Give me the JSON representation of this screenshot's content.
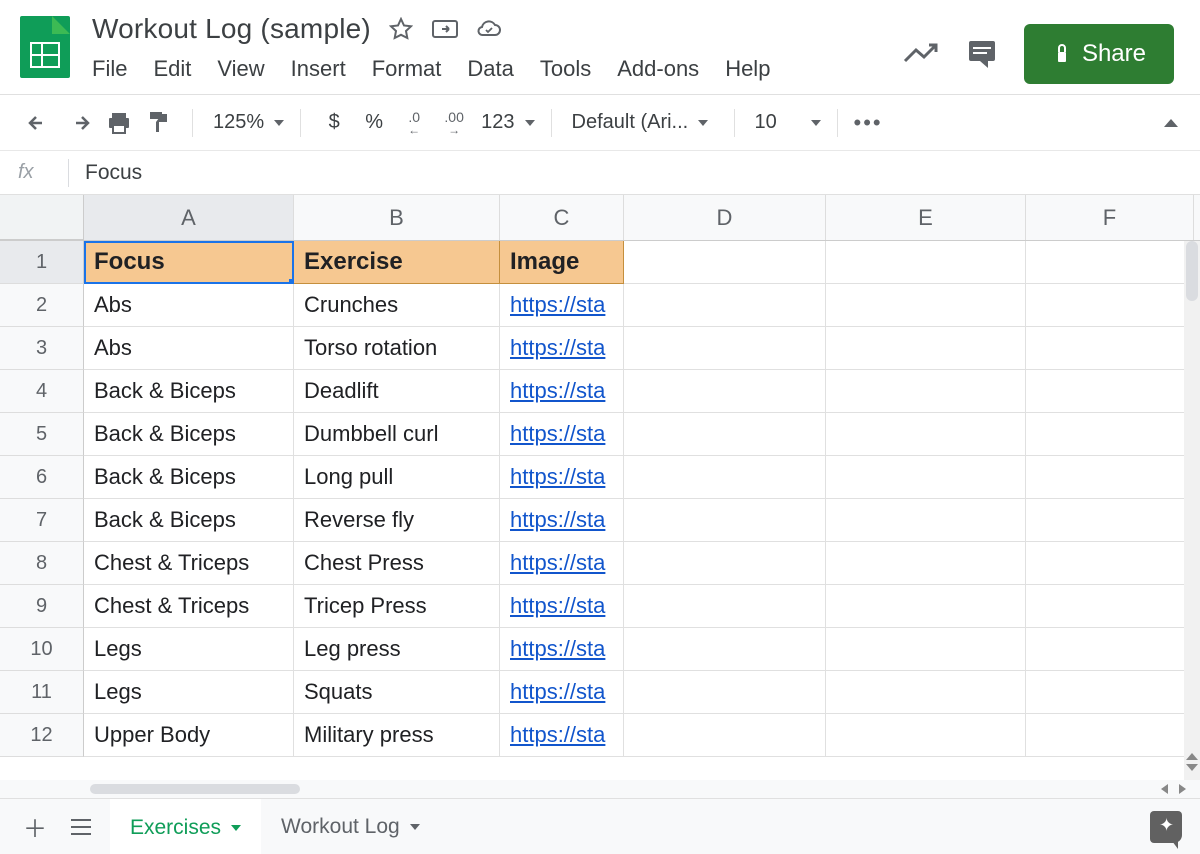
{
  "doc": {
    "title": "Workout Log (sample)"
  },
  "menus": [
    "File",
    "Edit",
    "View",
    "Insert",
    "Format",
    "Data",
    "Tools",
    "Add-ons",
    "Help"
  ],
  "share_label": "Share",
  "toolbar": {
    "zoom": "125%",
    "currency": "$",
    "percent": "%",
    "dec_less": ".0",
    "dec_more": ".00",
    "num_format": "123",
    "font": "Default (Ari...",
    "font_size": "10"
  },
  "formula_bar": {
    "label": "fx",
    "value": "Focus"
  },
  "columns": [
    "A",
    "B",
    "C",
    "D",
    "E",
    "F"
  ],
  "selected_cell": "A1",
  "headers": {
    "A": "Focus",
    "B": "Exercise",
    "C": "Image"
  },
  "rows": [
    {
      "n": "1"
    },
    {
      "n": "2",
      "A": "Abs",
      "B": "Crunches",
      "C": "https://sta"
    },
    {
      "n": "3",
      "A": "Abs",
      "B": "Torso rotation",
      "C": "https://sta"
    },
    {
      "n": "4",
      "A": "Back & Biceps",
      "B": "Deadlift",
      "C": "https://sta"
    },
    {
      "n": "5",
      "A": "Back & Biceps",
      "B": "Dumbbell curl",
      "C": "https://sta"
    },
    {
      "n": "6",
      "A": "Back & Biceps",
      "B": "Long pull",
      "C": "https://sta"
    },
    {
      "n": "7",
      "A": "Back & Biceps",
      "B": "Reverse fly",
      "C": "https://sta"
    },
    {
      "n": "8",
      "A": "Chest & Triceps",
      "B": "Chest Press",
      "C": "https://sta"
    },
    {
      "n": "9",
      "A": "Chest & Triceps",
      "B": "Tricep Press",
      "C": "https://sta"
    },
    {
      "n": "10",
      "A": "Legs",
      "B": "Leg press",
      "C": "https://sta"
    },
    {
      "n": "11",
      "A": "Legs",
      "B": "Squats",
      "C": "https://sta"
    },
    {
      "n": "12",
      "A": "Upper Body",
      "B": "Military press",
      "C": "https://sta"
    }
  ],
  "sheets": [
    {
      "name": "Exercises",
      "active": true
    },
    {
      "name": "Workout Log",
      "active": false
    }
  ]
}
